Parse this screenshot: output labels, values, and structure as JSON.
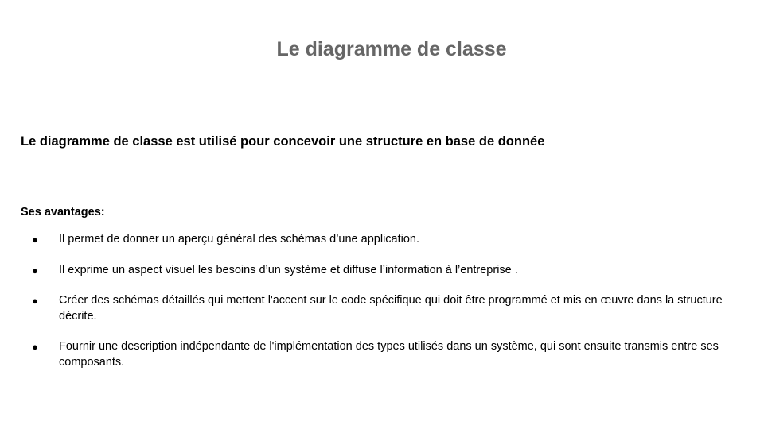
{
  "slide": {
    "title": "Le diagramme de classe",
    "intro": "Le diagramme de classe est utilisé pour concevoir une structure en base de donnée",
    "advantages_heading": "Ses avantages:",
    "bullet_glyph": "●",
    "advantages": [
      "Il permet de  donner un aperçu général des schémas d’une application.",
      "Il exprime  un aspect visuel  les besoins d’un système et diffuse l’information  à l’entreprise .",
      "Créer des schémas détaillés qui mettent l'accent sur le code spécifique qui doit être programmé et mis en œuvre dans la structure décrite.",
      "Fournir une description indépendante de l'implémentation des types utilisés dans un système, qui sont ensuite transmis entre ses composants."
    ],
    "colors": {
      "title": "#666666",
      "text": "#000000",
      "background": "#ffffff"
    }
  }
}
